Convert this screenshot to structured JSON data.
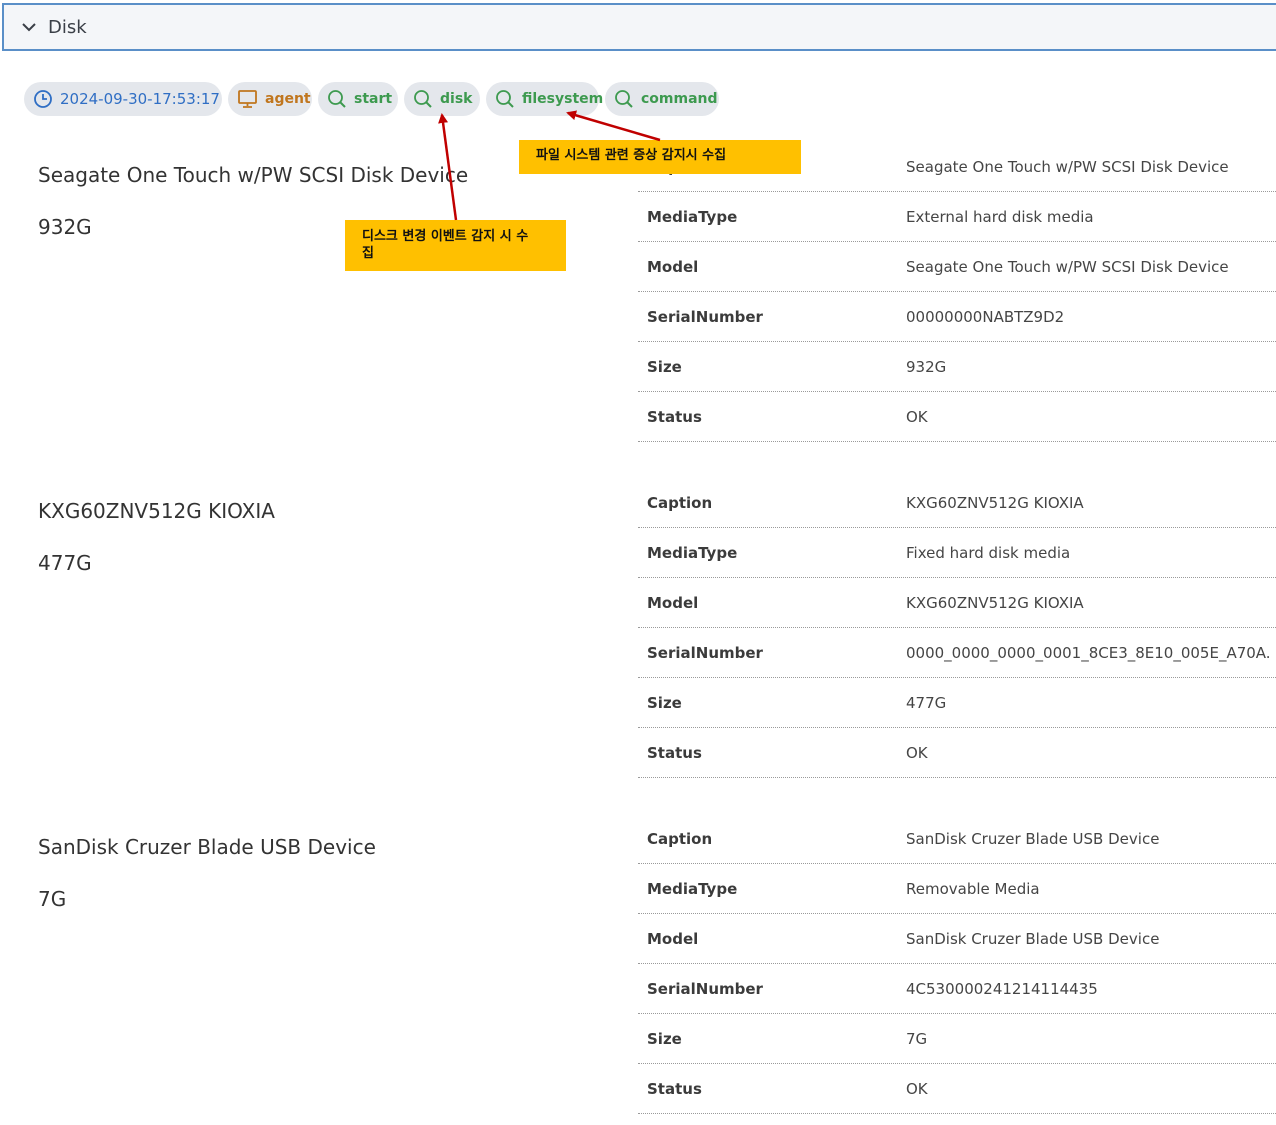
{
  "panel": {
    "title": "Disk"
  },
  "tags": {
    "timestamp": "2024-09-30-17:53:17",
    "agent": "agent",
    "start": "start",
    "disk": "disk",
    "filesystem": "filesystem",
    "command": "command"
  },
  "annotations": {
    "filesystem_note": "파일 시스템 관련 증상 감지시 수집",
    "disk_note": "디스크 변경 이벤트 감지 시 수집"
  },
  "disks": [
    {
      "name": "Seagate One Touch w/PW SCSI Disk Device",
      "size": "932G",
      "props": [
        {
          "key": "Caption",
          "value": "Seagate One Touch w/PW SCSI Disk Device"
        },
        {
          "key": "MediaType",
          "value": "External hard disk media"
        },
        {
          "key": "Model",
          "value": "Seagate One Touch w/PW SCSI Disk Device"
        },
        {
          "key": "SerialNumber",
          "value": "00000000NABTZ9D2"
        },
        {
          "key": "Size",
          "value": "932G"
        },
        {
          "key": "Status",
          "value": "OK"
        }
      ]
    },
    {
      "name": "KXG60ZNV512G KIOXIA",
      "size": "477G",
      "props": [
        {
          "key": "Caption",
          "value": "KXG60ZNV512G KIOXIA"
        },
        {
          "key": "MediaType",
          "value": "Fixed hard disk media"
        },
        {
          "key": "Model",
          "value": "KXG60ZNV512G KIOXIA"
        },
        {
          "key": "SerialNumber",
          "value": "0000_0000_0000_0001_8CE3_8E10_005E_A70A."
        },
        {
          "key": "Size",
          "value": "477G"
        },
        {
          "key": "Status",
          "value": "OK"
        }
      ]
    },
    {
      "name": "SanDisk Cruzer Blade USB Device",
      "size": "7G",
      "props": [
        {
          "key": "Caption",
          "value": "SanDisk Cruzer Blade USB Device"
        },
        {
          "key": "MediaType",
          "value": "Removable Media"
        },
        {
          "key": "Model",
          "value": "SanDisk Cruzer Blade USB Device"
        },
        {
          "key": "SerialNumber",
          "value": "4C530000241214114435"
        },
        {
          "key": "Size",
          "value": "7G"
        },
        {
          "key": "Status",
          "value": "OK"
        }
      ]
    }
  ],
  "colors": {
    "header_border": "#5a8fc8",
    "tag_bg": "#e4e7ec",
    "time_tag": "#2f6ec4",
    "agent_tag": "#c0761e",
    "search_tag": "#3d9a4f",
    "note_bg": "#ffc000",
    "arrow": "#c00000"
  },
  "icons": {
    "collapse": "chevron-down-icon",
    "timestamp": "clock-icon",
    "agent": "monitor-icon",
    "search": "search-icon"
  }
}
